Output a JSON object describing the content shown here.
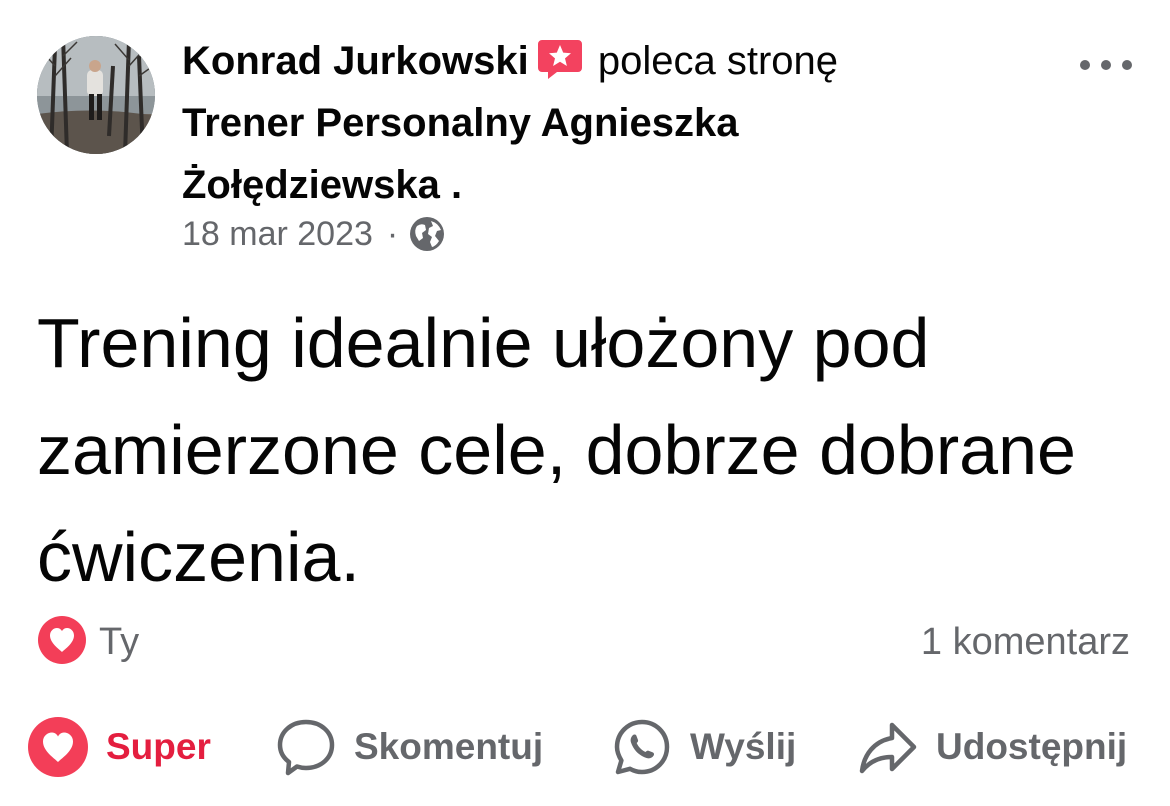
{
  "post": {
    "author": "Konrad Jurkowski",
    "action_text": "poleca stronę",
    "page_name": "Trener Personalny Agnieszka Żołędziewska",
    "page_suffix": ".",
    "date": "18 mar 2023",
    "date_separator": "·",
    "audience_icon": "globe-icon",
    "recommend_icon": "star-speech-bubble-icon",
    "recommend_color": "#f3425f",
    "text": "Trening idealnie ułożony pod zamierzone cele, dobrze dobrane ćwiczenia."
  },
  "reactions": {
    "icon": "heart-reaction-icon",
    "icon_color": "#f33e58",
    "by": "Ty",
    "comment_count": "1 komentarz"
  },
  "actions": {
    "like_label": "Super",
    "comment_label": "Skomentuj",
    "send_label": "Wyślij",
    "share_label": "Udostępnij",
    "active_color": "#e41e3f",
    "muted_color": "#65676b"
  }
}
